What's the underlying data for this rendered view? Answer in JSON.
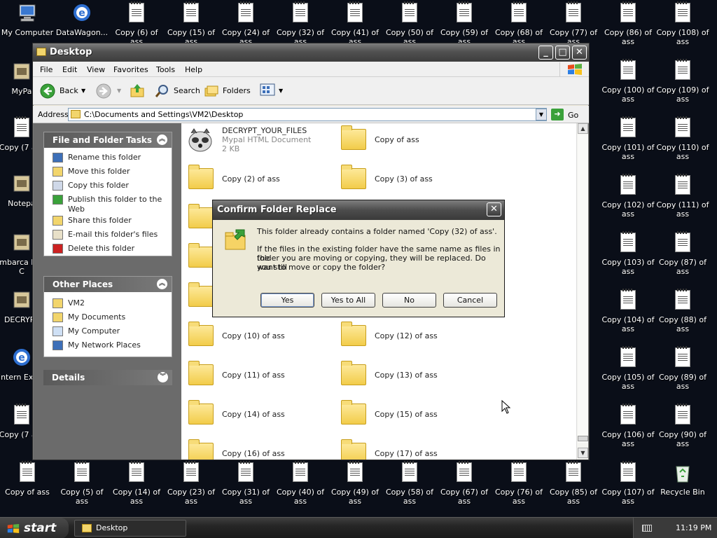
{
  "desktop_icons": [
    {
      "label": "My Computer",
      "type": "computer"
    },
    {
      "label": "DataWagon...",
      "type": "ie"
    },
    {
      "label": "Copy (6) of ass",
      "type": "doc"
    },
    {
      "label": "Copy (15) of ass",
      "type": "doc"
    },
    {
      "label": "Copy (24) of ass",
      "type": "doc"
    },
    {
      "label": "Copy (32) of ass",
      "type": "doc"
    },
    {
      "label": "Copy (41) of ass",
      "type": "doc"
    },
    {
      "label": "Copy (50) of ass",
      "type": "doc"
    },
    {
      "label": "Copy (59) of ass",
      "type": "doc"
    },
    {
      "label": "Copy (68) of ass",
      "type": "doc"
    },
    {
      "label": "Copy (77) of ass",
      "type": "doc"
    },
    {
      "label": "Copy (86) of ass",
      "type": "doc"
    },
    {
      "label": "Copy (108) of ass",
      "type": "doc"
    },
    {
      "label": "Copy (100) of ass",
      "type": "doc"
    },
    {
      "label": "Copy (109) of ass",
      "type": "doc"
    },
    {
      "label": "Copy (101) of ass",
      "type": "doc"
    },
    {
      "label": "Copy (110) of ass",
      "type": "doc"
    },
    {
      "label": "Copy (102) of ass",
      "type": "doc"
    },
    {
      "label": "Copy (111) of ass",
      "type": "doc"
    },
    {
      "label": "Copy (103) of ass",
      "type": "doc"
    },
    {
      "label": "Copy (87) of ass",
      "type": "doc"
    },
    {
      "label": "Copy (104) of ass",
      "type": "doc"
    },
    {
      "label": "Copy (88) of ass",
      "type": "doc"
    },
    {
      "label": "Copy (105) of ass",
      "type": "doc"
    },
    {
      "label": "Copy (89) of ass",
      "type": "doc"
    },
    {
      "label": "Copy (106) of ass",
      "type": "doc"
    },
    {
      "label": "Copy (90) of ass",
      "type": "doc"
    },
    {
      "label": "Copy of ass",
      "type": "doc"
    },
    {
      "label": "Copy (5) of ass",
      "type": "doc"
    },
    {
      "label": "Copy (14) of ass",
      "type": "doc"
    },
    {
      "label": "Copy (23) of ass",
      "type": "doc"
    },
    {
      "label": "Copy (31) of ass",
      "type": "doc"
    },
    {
      "label": "Copy (40) of ass",
      "type": "doc"
    },
    {
      "label": "Copy (49) of ass",
      "type": "doc"
    },
    {
      "label": "Copy (58) of ass",
      "type": "doc"
    },
    {
      "label": "Copy (67) of ass",
      "type": "doc"
    },
    {
      "label": "Copy (76) of ass",
      "type": "doc"
    },
    {
      "label": "Copy (85) of ass",
      "type": "doc"
    },
    {
      "label": "Copy (107) of ass",
      "type": "doc"
    },
    {
      "label": "Recycle Bin",
      "type": "recycle"
    },
    {
      "label": "MyPa",
      "type": "app"
    },
    {
      "label": "Copy (7 ass",
      "type": "doc"
    },
    {
      "label": "Notepa",
      "type": "app"
    },
    {
      "label": "Embarca Dev-C",
      "type": "app"
    },
    {
      "label": "DECRYPT",
      "type": "app"
    },
    {
      "label": "Intern Explo",
      "type": "ie"
    },
    {
      "label": "Copy (7 ass",
      "type": "doc"
    }
  ],
  "window": {
    "title": "Desktop",
    "menu": [
      "File",
      "Edit",
      "View",
      "Favorites",
      "Tools",
      "Help"
    ],
    "toolbar": {
      "back": "Back",
      "search": "Search",
      "folders": "Folders"
    },
    "address_label": "Address",
    "address_value": "C:\\Documents and Settings\\VM2\\Desktop",
    "go_label": "Go"
  },
  "task_pane": {
    "file_tasks_title": "File and Folder Tasks",
    "file_tasks": [
      "Rename this folder",
      "Move this folder",
      "Copy this folder",
      "Publish this folder to the Web",
      "Share this folder",
      "E-mail this folder's files",
      "Delete this folder"
    ],
    "other_places_title": "Other Places",
    "other_places": [
      "VM2",
      "My Documents",
      "My Computer",
      "My Network Places"
    ],
    "details_title": "Details"
  },
  "files": [
    {
      "name": "DECRYPT_YOUR_FILES",
      "sub1": "Mypal HTML Document",
      "sub2": "2 KB",
      "type": "html"
    },
    {
      "name": "Copy of ass",
      "type": "folder"
    },
    {
      "name": "Copy (2) of ass",
      "type": "folder"
    },
    {
      "name": "Copy (3) of ass",
      "type": "folder"
    },
    {
      "name": "",
      "type": "folder"
    },
    {
      "name": "",
      "type": "folder"
    },
    {
      "name": "",
      "type": "folder"
    },
    {
      "name": "",
      "type": "folder"
    },
    {
      "name": "",
      "type": "folder"
    },
    {
      "name": "",
      "type": "folder"
    },
    {
      "name": "Copy (10) of ass",
      "type": "folder"
    },
    {
      "name": "Copy (12) of ass",
      "type": "folder"
    },
    {
      "name": "Copy (11) of ass",
      "type": "folder"
    },
    {
      "name": "Copy (13) of ass",
      "type": "folder"
    },
    {
      "name": "Copy (14) of ass",
      "type": "folder"
    },
    {
      "name": "Copy (15) of ass",
      "type": "folder"
    },
    {
      "name": "Copy (16) of ass",
      "type": "folder"
    },
    {
      "name": "Copy (17) of ass",
      "type": "folder"
    }
  ],
  "dialog": {
    "title": "Confirm Folder Replace",
    "line1": "This folder already contains a folder named 'Copy (32) of ass'.",
    "line2": "If the files in the existing folder have the same name as files in the",
    "line3": "folder you are moving or copying, they will be replaced.  Do you still",
    "line4": "want to move or copy the folder?",
    "buttons": {
      "yes": "Yes",
      "yes_all": "Yes to All",
      "no": "No",
      "cancel": "Cancel"
    }
  },
  "taskbar": {
    "start": "start",
    "task": "Desktop",
    "clock": "11:19 PM"
  }
}
